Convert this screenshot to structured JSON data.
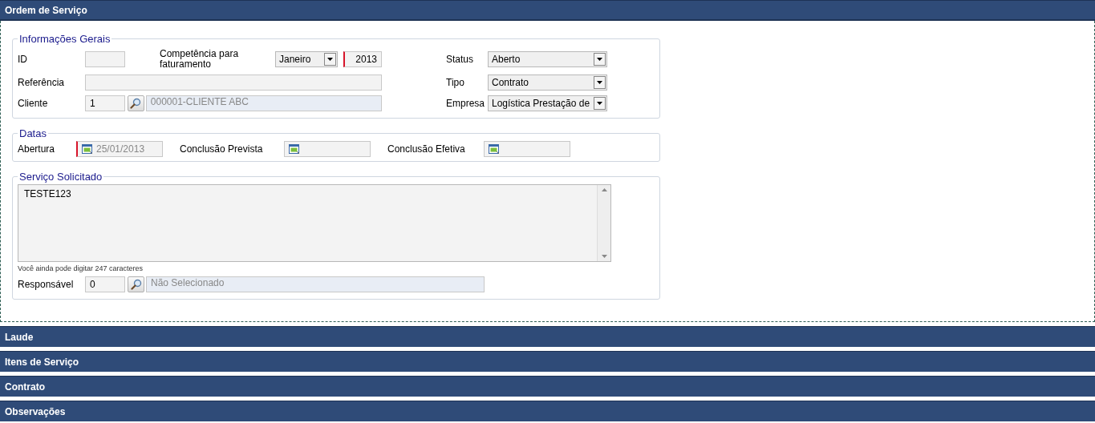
{
  "sections": [
    {
      "title": "Ordem de Serviço",
      "expanded": true
    },
    {
      "title": "Laude",
      "expanded": false
    },
    {
      "title": "Itens de Serviço",
      "expanded": false
    },
    {
      "title": "Contrato",
      "expanded": false
    },
    {
      "title": "Observações",
      "expanded": false
    }
  ],
  "general": {
    "legend": "Informações Gerais",
    "id": {
      "label": "ID"
    },
    "competencia": {
      "label": "Competência para faturamento",
      "month": "Janeiro",
      "year": "2013",
      "year_required": true
    },
    "referencia": {
      "label": "Referência"
    },
    "cliente": {
      "label": "Cliente",
      "code": "1",
      "name": "000001-CLIENTE ABC"
    },
    "status": {
      "label": "Status",
      "value": "Aberto"
    },
    "tipo": {
      "label": "Tipo",
      "value": "Contrato"
    },
    "empresa": {
      "label": "Empresa",
      "value": "Logística Prestação de"
    }
  },
  "dates": {
    "legend": "Datas",
    "fields": [
      {
        "label": "Abertura",
        "value": "25/01/2013",
        "required": true
      },
      {
        "label": "Conclusão Prevista",
        "required": false
      },
      {
        "label": "Conclusão Efetiva",
        "required": false
      }
    ]
  },
  "service": {
    "legend": "Serviço Solicitado",
    "text": "TESTE123",
    "counter": "Você ainda pode digitar 247 caracteres",
    "responsavel": {
      "label": "Responsável",
      "code": "0",
      "name": "Não Selecionado"
    }
  }
}
